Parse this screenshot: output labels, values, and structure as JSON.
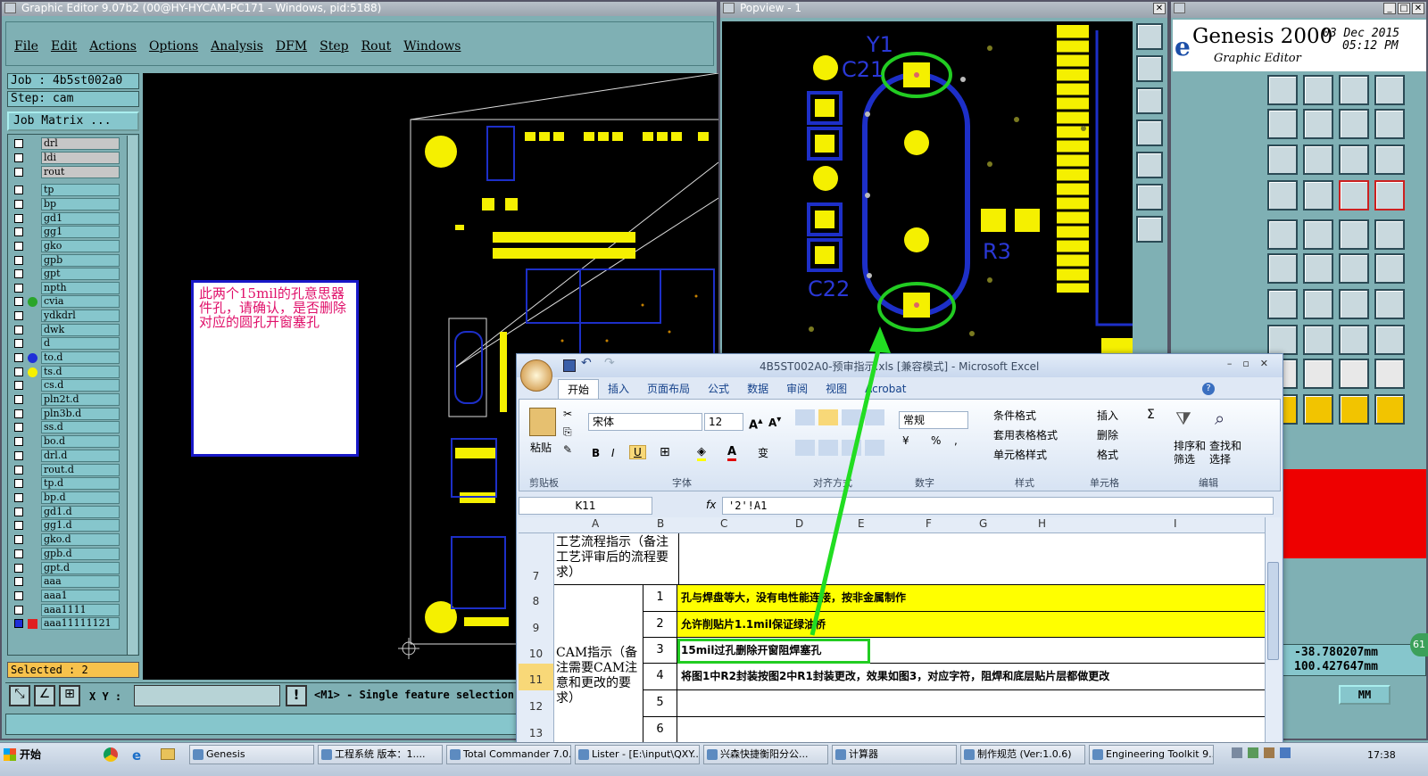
{
  "editor": {
    "title": "Graphic Editor 9.07b2 (00@HY-HYCAM-PC171 - Windows, pid:5188)",
    "menu": [
      "File",
      "Edit",
      "Actions",
      "Options",
      "Analysis",
      "DFM",
      "Step",
      "Rout",
      "Windows"
    ],
    "job": "Job : 4b5st002a0",
    "step": "Step: cam",
    "job_matrix": "Job Matrix ...",
    "layers": [
      "drl",
      "ldi",
      "rout",
      "tp",
      "bp",
      "gd1",
      "gg1",
      "gko",
      "gpb",
      "gpt",
      "npth",
      "cvia",
      "ydkdrl",
      "dwk",
      "d",
      "to.d",
      "ts.d",
      "cs.d",
      "pln2t.d",
      "pln3b.d",
      "ss.d",
      "bo.d",
      "drl.d",
      "rout.d",
      "tp.d",
      "bp.d",
      "gd1.d",
      "gg1.d",
      "gko.d",
      "gpb.d",
      "gpt.d",
      "aaa",
      "aaa1",
      "aaa1111",
      "aaa11111121"
    ],
    "selected": "Selected : 2",
    "xy_label": "X Y :",
    "status": "<M1> - Single feature selection ;",
    "note": "此两个15mil的孔意思器件孔，请确认，是否删除对应的圆孔开窗塞孔"
  },
  "popview": {
    "title": "Popview - 1",
    "labels": {
      "y1": "Y1",
      "c21": "C21",
      "c22": "C22",
      "r3": "R3"
    }
  },
  "genesis": {
    "title": "Genesis 2000",
    "date": "03 Dec 2015",
    "time": "05:12 PM",
    "subtitle": "Graphic Editor",
    "logo": "e",
    "coord_x": "-38.780207mm",
    "coord_y": "100.427647mm",
    "unit": "MM",
    "badge": "61"
  },
  "excel": {
    "title": "4B5ST002A0-预审指示.xls [兼容模式] - Microsoft Excel",
    "tabs": [
      "开始",
      "插入",
      "页面布局",
      "公式",
      "数据",
      "审阅",
      "视图",
      "Acrobat"
    ],
    "font_name": "宋体",
    "font_size": "12",
    "number_format": "常规",
    "groups": [
      "剪贴板",
      "字体",
      "对齐方式",
      "数字",
      "样式",
      "单元格",
      "编辑"
    ],
    "paste": "粘贴",
    "style_btns": [
      "条件格式",
      "套用表格格式",
      "单元格样式"
    ],
    "cell_btns": [
      "插入",
      "删除",
      "格式"
    ],
    "edit_btns": [
      "排序和筛选",
      "查找和选择"
    ],
    "name_box": "K11",
    "formula": "'2'!A1",
    "columns": [
      "A",
      "B",
      "C",
      "D",
      "E",
      "F",
      "G",
      "H",
      "I"
    ],
    "rows": [
      {
        "num": "7",
        "a": "工艺流程指示（备注工艺评审后的流程要求）",
        "b": "",
        "c": ""
      },
      {
        "num": "8",
        "a": "",
        "b": "1",
        "c": "孔与焊盘等大，没有电性能连接，按非金属制作"
      },
      {
        "num": "9",
        "a": "",
        "b": "2",
        "c": "允许削贴片1.1mil保证绿油桥"
      },
      {
        "num": "10",
        "a": "",
        "b": "3",
        "c": "15mil过孔删除开窗阻焊塞孔"
      },
      {
        "num": "11",
        "a": "CAM指示（备注需要CAM注意和更改的要求）",
        "b": "4",
        "c": "将图1中R2封装按图2中R1封装更改，效果如图3，对应字符，阻焊和底层贴片层都做更改"
      },
      {
        "num": "12",
        "a": "",
        "b": "5",
        "c": ""
      },
      {
        "num": "13",
        "a": "",
        "b": "6",
        "c": ""
      }
    ]
  },
  "taskbar": {
    "start": "开始",
    "items": [
      "Genesis",
      "工程系统 版本：1....",
      "Total Commander 7.0...",
      "Lister - [E:\\input\\QXY...",
      "兴森快捷衡阳分公...",
      "计算器",
      "制作规范 (Ver:1.0.6)",
      "Engineering Toolkit 9...."
    ],
    "clock": "17:38"
  }
}
